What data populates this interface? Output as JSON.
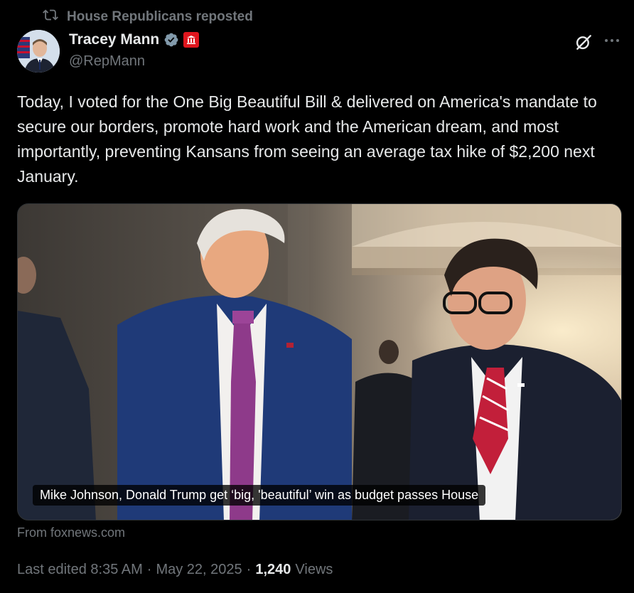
{
  "repost": {
    "text": "House Republicans reposted",
    "icon": "repost-icon"
  },
  "author": {
    "name": "Tracey Mann",
    "handle": "@RepMann",
    "verified_icon": "verified-badge-icon",
    "affiliation_icon": "government-affiliation-icon",
    "badge_color": "#829aab",
    "affiliation_color": "#e0161e"
  },
  "actions": {
    "grok_icon": "grok-icon",
    "more_icon": "more-icon"
  },
  "tweet": {
    "text": "Today, I voted for the One Big Beautiful Bill & delivered on America's mandate to secure our borders, promote hard work and the American dream, and most importantly, preventing Kansans from seeing an average tax hike of $2,200 next January."
  },
  "card": {
    "headline": "Mike Johnson, Donald Trump get ‘big, 'beautiful’ win as budget passes House",
    "source": "From foxnews.com"
  },
  "meta": {
    "edited_time": "Last edited 8:35 AM",
    "separator": "·",
    "date": "May 22, 2025",
    "views_count": "1,240",
    "views_label": "Views"
  },
  "colors": {
    "background": "#000000",
    "text": "#e7e9ea",
    "muted": "#71767b"
  }
}
